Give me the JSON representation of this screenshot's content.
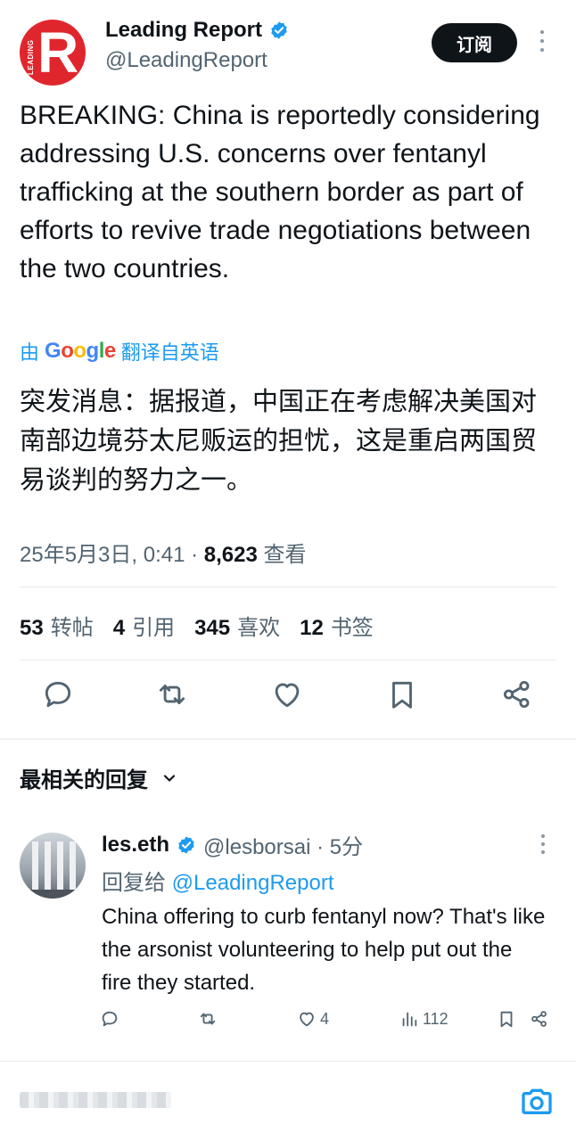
{
  "author": {
    "avatar_text": "R",
    "avatar_subtext": "LEADING",
    "name": "Leading Report",
    "handle": "@LeadingReport"
  },
  "subscribe_label": "订阅",
  "tweet": {
    "text": "BREAKING: China is reportedly considering addressing U.S. concerns over fentanyl trafficking at the southern border as part of efforts to revive trade negotiations between the two countries.",
    "translate_prefix": "由",
    "translate_google": "Google",
    "translate_suffix": "翻译自英语",
    "translated_text": "突发消息：据报道，中国正在考虑解决美国对南部边境芬太尼贩运的担忧，这是重启两国贸易谈判的努力之一。",
    "timestamp": "25年5月3日, 0:41 · ",
    "views_count": "8,623",
    "views_label": " 查看"
  },
  "stats": {
    "reposts_count": "53",
    "reposts_label": "转帖",
    "quotes_count": "4",
    "quotes_label": "引用",
    "likes_count": "345",
    "likes_label": "喜欢",
    "bookmarks_count": "12",
    "bookmarks_label": "书签"
  },
  "replies_header": "最相关的回复",
  "reply": {
    "name": "les.eth",
    "handle_time": "@lesborsai · 5分",
    "reply_to_prefix": "回复给 ",
    "reply_to_handle": "@LeadingReport",
    "text": "China offering to curb fentanyl now? That's like the arsonist volunteering to help put out the fire they started.",
    "likes": "4",
    "views": "112"
  },
  "colors": {
    "accent": "#1d9bf0",
    "secondary_text": "#536471",
    "brand_red": "#e0262d"
  }
}
